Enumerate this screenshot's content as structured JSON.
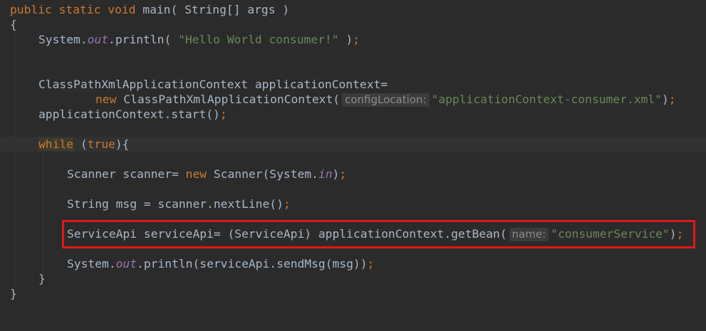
{
  "editor": {
    "lines": {
      "sig_kw": "public static void",
      "sig_name": "main",
      "sig_params": "( String[] args )",
      "open1": "{",
      "l3_a": "System.",
      "l3_field": "out",
      "l3_b": ".println( ",
      "l3_str": "\"Hello World consumer!\"",
      "l3_c": " )",
      "l3_semi": ";",
      "l6": "ClassPathXmlApplicationContext applicationContext=",
      "l7_kw": "new",
      "l7_a": " ClassPathXmlApplicationContext(",
      "l7_hint": "configLocation:",
      "l7_str": "\"applicationContext-consumer.xml\"",
      "l7_b": ")",
      "l7_semi": ";",
      "l8_a": "applicationContext.start()",
      "l8_semi": ";",
      "l10_kw": "while",
      "l10_a": " (",
      "l10_true": "true",
      "l10_b": "){",
      "l12_a": "Scanner scanner= ",
      "l12_kw": "new",
      "l12_b": " Scanner(System.",
      "l12_field": "in",
      "l12_c": ")",
      "l12_semi": ";",
      "l14_a": "String msg = scanner.nextLine()",
      "l14_semi": ";",
      "l16_a": "ServiceApi serviceApi= (ServiceApi) applicationContext.getBean(",
      "l16_hint": "name:",
      "l16_str": "\"consumerService\"",
      "l16_b": ")",
      "l16_semi": ";",
      "l18_a": "System.",
      "l18_field": "out",
      "l18_b": ".println(serviceApi.sendMsg(msg))",
      "l18_semi": ";",
      "close_while": "}",
      "close_main": "}"
    },
    "colors": {
      "background": "#2b2b2b",
      "keyword": "#cc7832",
      "string": "#6a8759",
      "field": "#9876aa",
      "text": "#a9b7c6",
      "highlight_border": "#e01818"
    }
  }
}
